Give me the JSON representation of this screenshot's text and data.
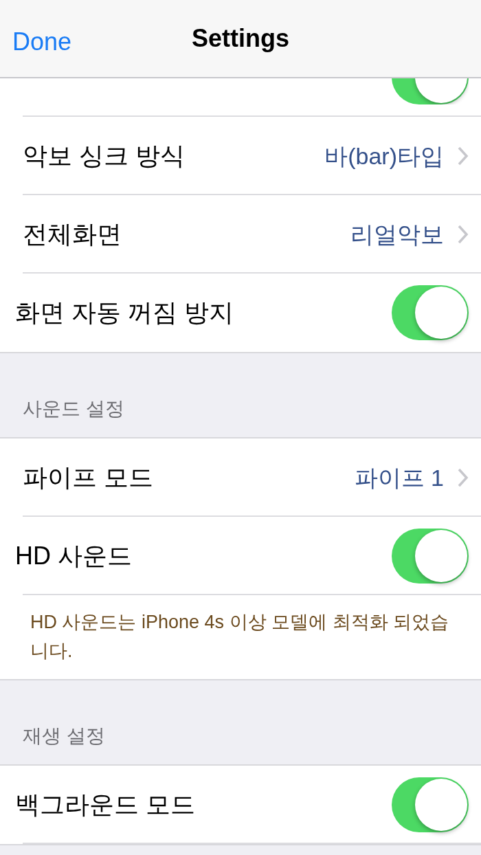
{
  "nav_bar": {
    "done_button": "Done",
    "title": "Settings"
  },
  "partial_row": {
    "on": true
  },
  "sections": [
    {
      "rows": [
        {
          "kind": "link",
          "label": "악보 싱크 방식",
          "value": "바(bar)타입"
        },
        {
          "kind": "link",
          "label": "전체화면",
          "value": "리얼악보"
        },
        {
          "kind": "toggle",
          "label": "화면 자동 꺼짐 방지",
          "on": true
        }
      ]
    },
    {
      "header": "사운드 설정",
      "rows": [
        {
          "kind": "link",
          "label": "파이프 모드",
          "value": "파이프 1"
        },
        {
          "kind": "toggle",
          "label": "HD 사운드",
          "on": true
        }
      ],
      "footer": "HD 사운드는 iPhone 4s 이상 모델에 최적화 되었습니다."
    },
    {
      "header": "재생 설정",
      "rows": [
        {
          "kind": "toggle",
          "label": "백그라운드 모드",
          "on": true
        }
      ]
    }
  ]
}
